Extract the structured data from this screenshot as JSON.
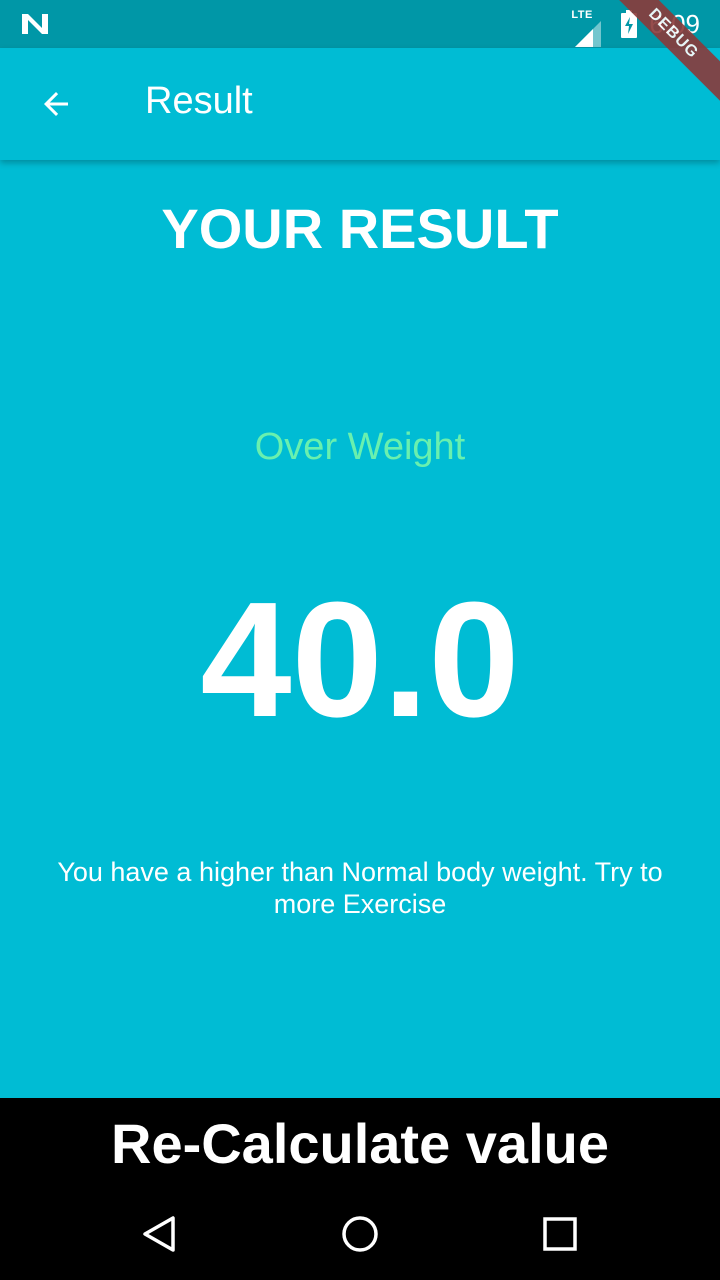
{
  "status_bar": {
    "network": "LTE",
    "time": "6:09",
    "debug_banner": "DEBUG"
  },
  "app_bar": {
    "back_icon": "arrow-left-icon",
    "title": "Result"
  },
  "content": {
    "heading": "YOUR RESULT",
    "category": "Over Weight",
    "value": "40.0",
    "message": "You have a higher than Normal body weight. Try to more Exercise"
  },
  "bottom_button": {
    "label": "Re-Calculate value"
  },
  "nav_bar": {
    "back_icon": "triangle-back-icon",
    "home_icon": "circle-home-icon",
    "recent_icon": "square-recents-icon"
  },
  "colors": {
    "primary": "#00BCD4",
    "status_bar": "#0097A7",
    "category_text": "#69F0AE",
    "button_bg": "#000000",
    "text": "#FFFFFF"
  }
}
